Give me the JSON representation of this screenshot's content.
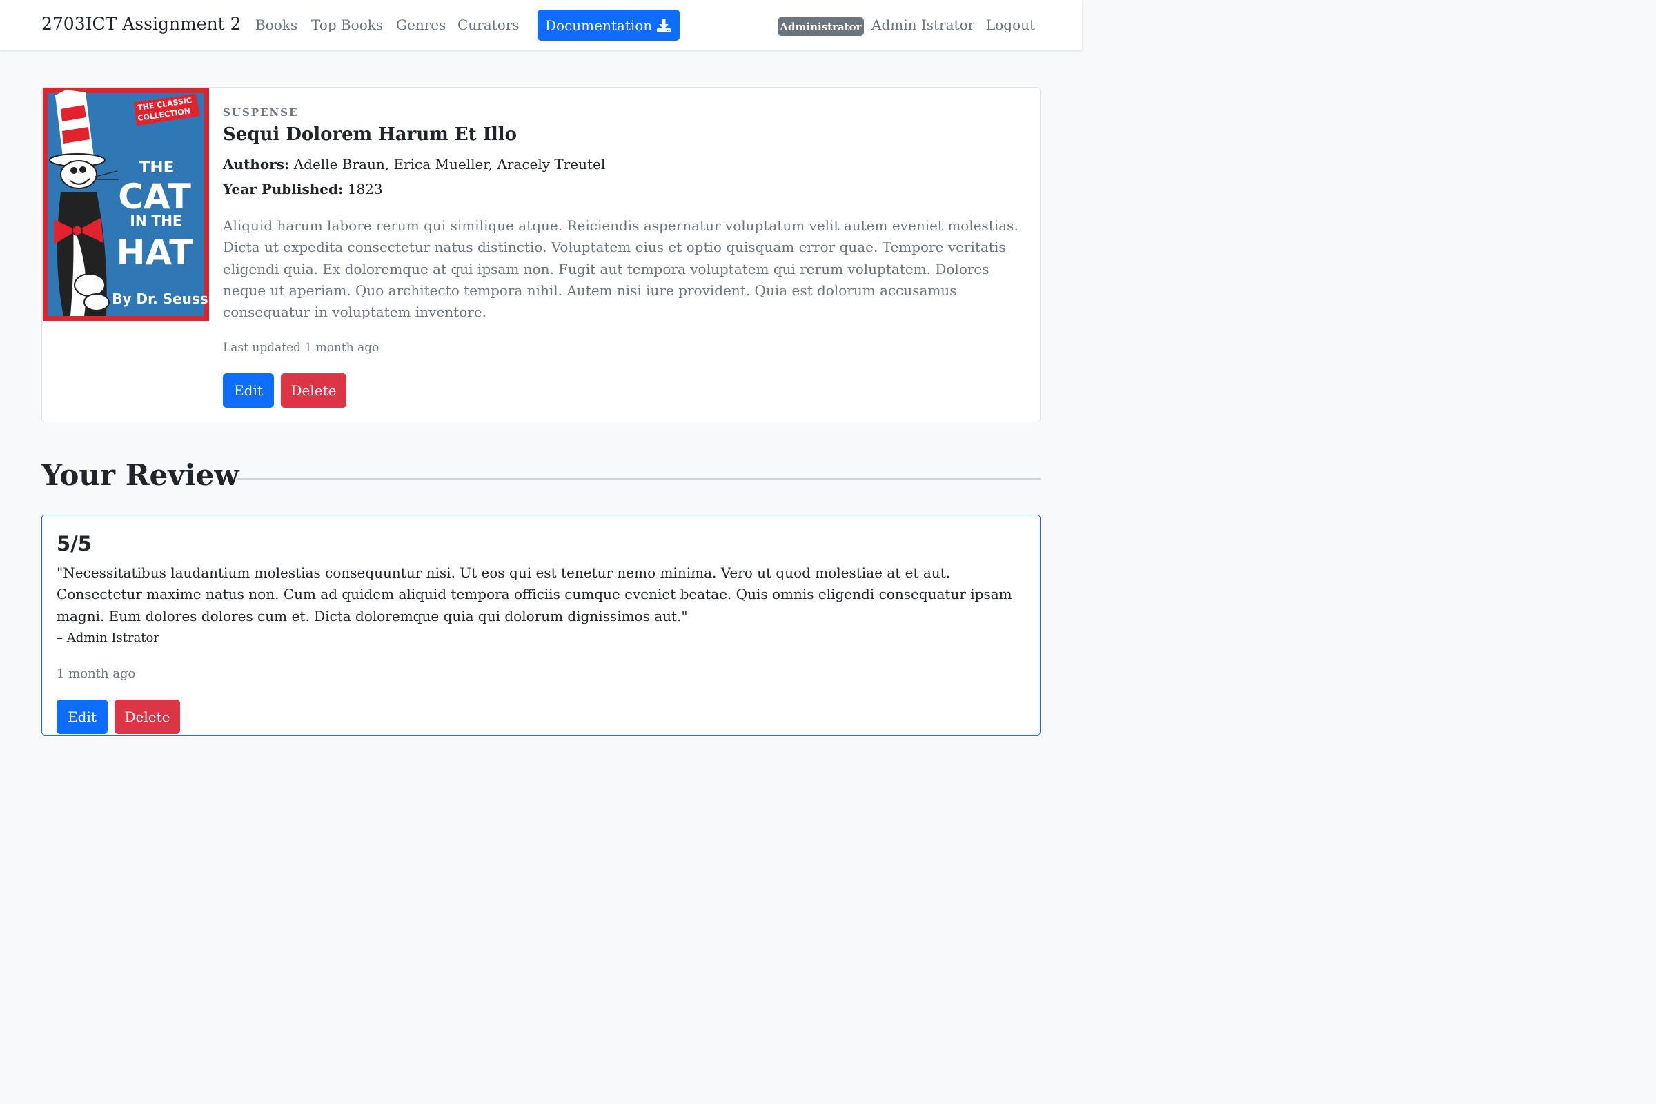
{
  "navbar": {
    "brand": "2703ICT Assignment 2",
    "links": [
      "Books",
      "Top Books",
      "Genres",
      "Curators"
    ],
    "documentation_label": "Documentation",
    "role_badge": "Administrator",
    "user_name": "Admin Istrator",
    "logout_label": "Logout"
  },
  "book": {
    "genre": "SUSPENSE",
    "title": "Sequi Dolorem Harum Et Illo",
    "authors_label": "Authors:",
    "authors": "Adelle Braun, Erica Mueller, Aracely Treutel",
    "year_label": "Year Published:",
    "year": "1823",
    "description": "Aliquid harum labore rerum qui similique atque. Reiciendis aspernatur voluptatum velit autem eveniet molestias. Dicta ut expedita consectetur natus distinctio. Voluptatem eius et optio quisquam error quae. Tempore veritatis eligendi quia. Ex doloremque at qui ipsam non. Fugit aut tempora voluptatem qui rerum voluptatem. Dolores neque ut aperiam. Quo architecto tempora nihil. Autem nisi iure provident. Quia est dolorum accusamus consequatur in voluptatem inventore.",
    "last_updated": "Last updated 1 month ago",
    "edit_label": "Edit",
    "delete_label": "Delete",
    "cover": {
      "badge_line1": "THE CLASSIC",
      "badge_line2": "COLLECTION",
      "title_line1": "THE",
      "title_line2": "CAT",
      "title_line3": "IN THE",
      "title_line4": "HAT",
      "author": "By Dr. Seuss",
      "colors": {
        "frame": "#e1232d",
        "panel": "#2f78b5",
        "text": "#ffffff"
      }
    }
  },
  "review_section": {
    "title": "Your Review",
    "score": "5/5",
    "text": "\"Necessitatibus laudantium molestias consequuntur nisi. Ut eos qui est tenetur nemo minima. Vero ut quod molestiae at et aut. Consectetur maxime natus non. Cum ad quidem aliquid tempora officiis cumque eveniet beatae. Quis omnis eligendi consequatur ipsam magni. Eum dolores dolores cum et. Dicta doloremque quia qui dolorum dignissimos aut.\"",
    "reviewer": "– Admin Istrator",
    "time": "1 month ago",
    "edit_label": "Edit",
    "delete_label": "Delete"
  },
  "colors": {
    "primary": "#0d6efd",
    "danger": "#dc3545",
    "secondary": "#6c757d",
    "page_bg": "#f8f9fa"
  }
}
